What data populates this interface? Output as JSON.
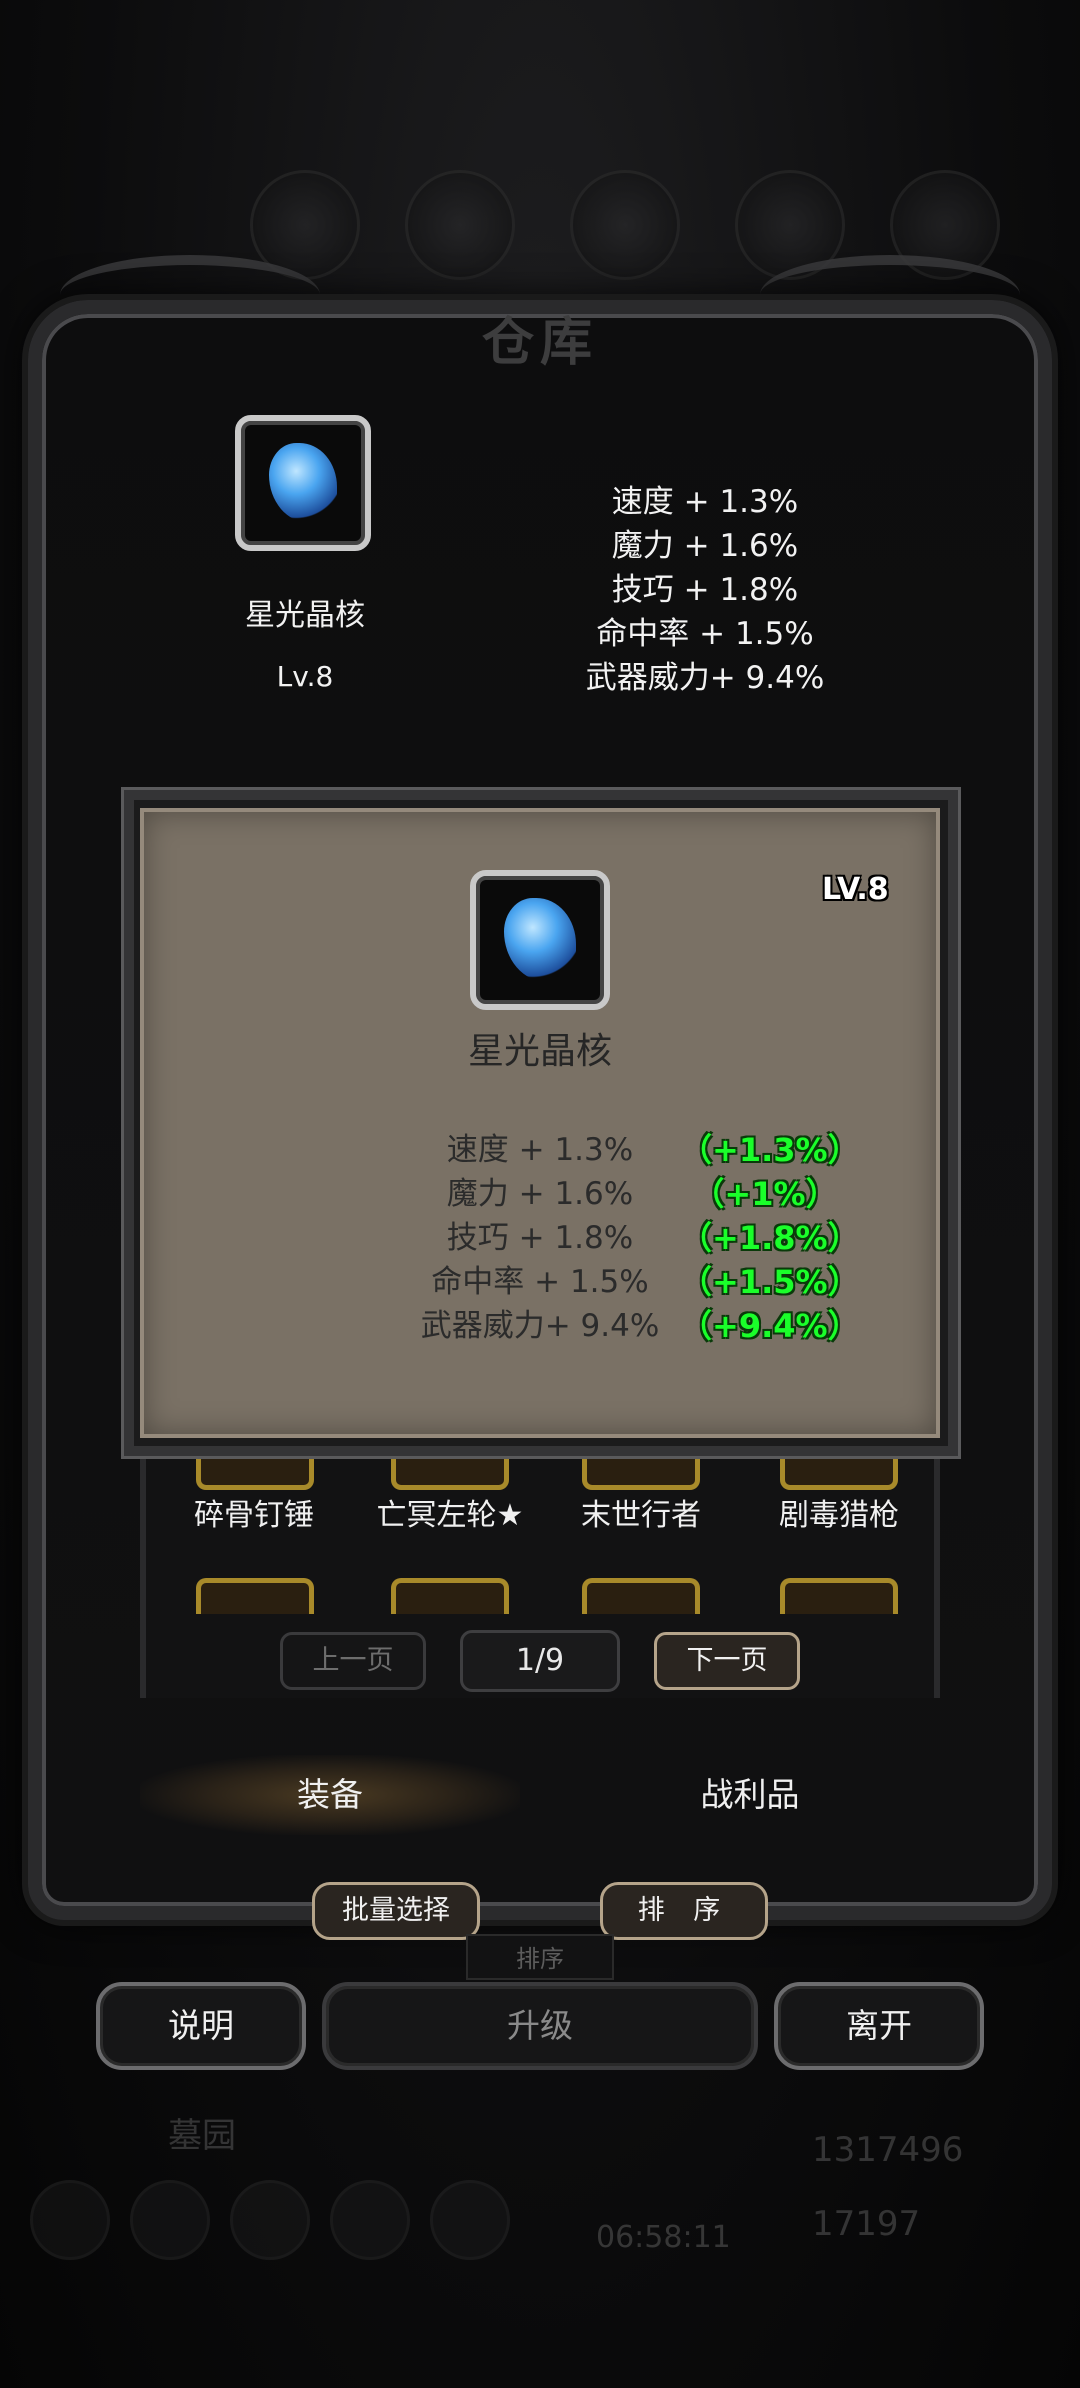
{
  "background": {
    "frame_title": "仓库",
    "bottom_left_label": "墓园",
    "timer": "06:58:11",
    "gold": "1317496",
    "gems": "17197"
  },
  "summary": {
    "item_name": "星光晶核",
    "level": "Lv.8",
    "icon": "crystal-shard-icon",
    "stats": [
      "速度 + 1.3%",
      "魔力 + 1.6%",
      "技巧 + 1.8%",
      "命中率 + 1.5%",
      "武器威力+ 9.4%"
    ]
  },
  "popup": {
    "level": "LV.8",
    "item_name": "星光晶核",
    "stats": [
      "速度 + 1.3%",
      "魔力 + 1.6%",
      "技巧 + 1.8%",
      "命中率 + 1.5%",
      "武器威力+ 9.4%"
    ],
    "bonuses": [
      "（+1.3%）",
      "（+1%）",
      "（+1.8%）",
      "（+1.5%）",
      "（+9.4%）"
    ],
    "bonus_color": "#1aff2a"
  },
  "inventory": {
    "items": [
      "碎骨钉锤",
      "亡冥左轮★",
      "末世行者",
      "剧毒猎枪"
    ]
  },
  "pagination": {
    "prev_label": "上一页",
    "page": "1/9",
    "next_label": "下一页"
  },
  "tabs": {
    "equipment": "装备",
    "loot": "战利品"
  },
  "actions": {
    "batch_select": "批量选择",
    "sort": "排 序",
    "sort_faded": "排序",
    "info": "说明",
    "upgrade": "升级",
    "leave": "离开"
  }
}
